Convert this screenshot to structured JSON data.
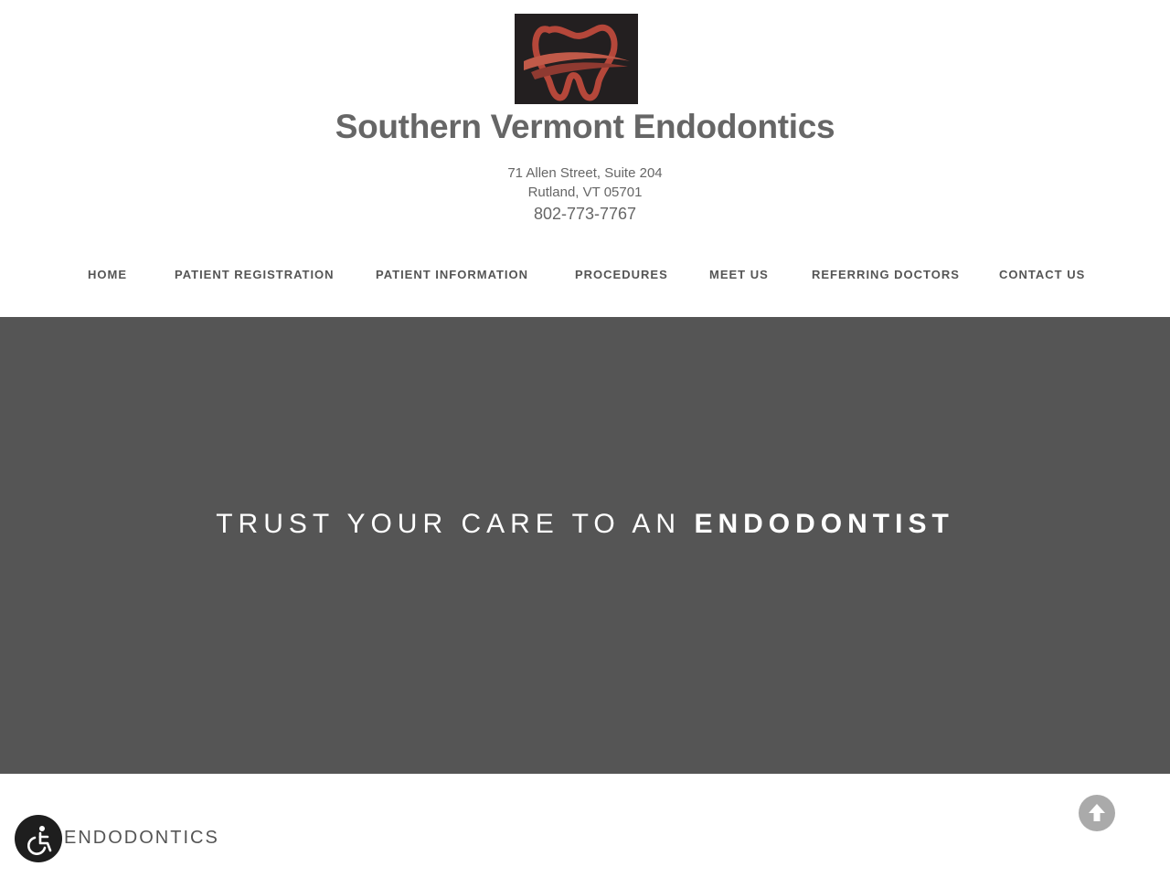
{
  "header": {
    "logo_icon": "tooth-logo-icon",
    "site_title": "Southern Vermont Endodontics",
    "address_line1": "71 Allen Street, Suite 204",
    "address_line2": "Rutland, VT 05701",
    "phone": "802-773-7767"
  },
  "nav": {
    "items": [
      {
        "label": "HOME"
      },
      {
        "label": "PATIENT REGISTRATION"
      },
      {
        "label": "PATIENT INFORMATION"
      },
      {
        "label": "PROCEDURES"
      },
      {
        "label": "MEET US"
      },
      {
        "label": "REFERRING DOCTORS"
      },
      {
        "label": "CONTACT US"
      }
    ]
  },
  "hero": {
    "text_light": "TRUST YOUR CARE TO AN",
    "text_bold": "ENDODONTIST",
    "background_color": "#555555"
  },
  "content": {
    "section_heading": "ENDODONTICS"
  },
  "widgets": {
    "accessibility_icon": "wheelchair-accessibility-icon",
    "scroll_top_icon": "arrow-up-icon"
  },
  "colors": {
    "logo_red": "#b5473a",
    "logo_bg": "#231f20",
    "text_gray": "#666666"
  }
}
